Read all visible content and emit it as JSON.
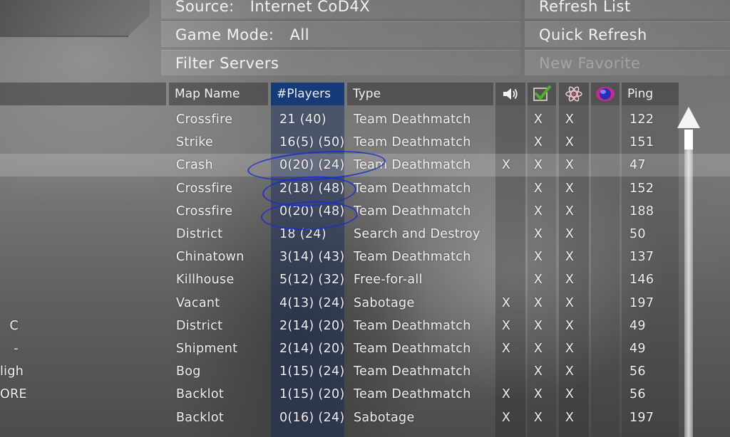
{
  "top": {
    "source_label": "Source:",
    "source_value": "Internet CoD4X",
    "gamemode_label": "Game Mode:",
    "gamemode_value": "All",
    "filter_label": "Filter Servers",
    "refresh_label": "Refresh List",
    "quick_refresh_label": "Quick Refresh",
    "new_favorite_label": "New Favorite"
  },
  "columns": {
    "map_name": "Map Name",
    "players": "#Players",
    "type": "Type",
    "voice_icon": "speaker-icon",
    "pure_icon": "checkmark-icon",
    "mod_icon": "atom-icon",
    "punkbuster_icon": "globe-icon",
    "ping": "Ping"
  },
  "rows": [
    {
      "left": "",
      "map": "Crossfire",
      "players": "21 (40)",
      "type": "Team Deathmatch",
      "voice": "",
      "pure": "X",
      "mod": "X",
      "pb": "",
      "ping": "122"
    },
    {
      "left": "",
      "map": "Strike",
      "players": "16(5) (50)",
      "type": "Team Deathmatch",
      "voice": "",
      "pure": "X",
      "mod": "X",
      "pb": "",
      "ping": "151"
    },
    {
      "left": "",
      "map": "Crash",
      "players": "0(20) (24)",
      "type": "Team Deathmatch",
      "voice": "X",
      "pure": "X",
      "mod": "X",
      "pb": "",
      "ping": "47"
    },
    {
      "left": "",
      "map": "Crossfire",
      "players": "2(18) (48)",
      "type": "Team Deathmatch",
      "voice": "",
      "pure": "X",
      "mod": "X",
      "pb": "",
      "ping": "152"
    },
    {
      "left": "",
      "map": "Crossfire",
      "players": "0(20) (48)",
      "type": "Team Deathmatch",
      "voice": "",
      "pure": "X",
      "mod": "X",
      "pb": "",
      "ping": "188"
    },
    {
      "left": "",
      "map": "District",
      "players": "18 (24)",
      "type": "Search and Destroy",
      "voice": "",
      "pure": "X",
      "mod": "X",
      "pb": "",
      "ping": "50"
    },
    {
      "left": "",
      "map": "Chinatown",
      "players": "3(14) (43)",
      "type": "Team Deathmatch",
      "voice": "",
      "pure": "X",
      "mod": "X",
      "pb": "",
      "ping": "137"
    },
    {
      "left": "",
      "map": "Killhouse",
      "players": "5(12) (32)",
      "type": "Free-for-all",
      "voice": "",
      "pure": "X",
      "mod": "X",
      "pb": "",
      "ping": "146"
    },
    {
      "left": "",
      "map": "Vacant",
      "players": "4(13) (24)",
      "type": "Sabotage",
      "voice": "X",
      "pure": "X",
      "mod": "X",
      "pb": "",
      "ping": "197"
    },
    {
      "left": "C",
      "map": "District",
      "players": "2(14) (20)",
      "type": "Team Deathmatch",
      "voice": "X",
      "pure": "X",
      "mod": "X",
      "pb": "",
      "ping": "49"
    },
    {
      "left": "-",
      "map": "Shipment",
      "players": "2(14) (20)",
      "type": "Team Deathmatch",
      "voice": "X",
      "pure": "X",
      "mod": "X",
      "pb": "",
      "ping": "49"
    },
    {
      "left": "ligh",
      "map": "Bog",
      "players": "1(15) (24)",
      "type": "Team Deathmatch",
      "voice": "",
      "pure": "X",
      "mod": "X",
      "pb": "",
      "ping": "56"
    },
    {
      "left": "ORE",
      "map": "Backlot",
      "players": "1(15) (20)",
      "type": "Team Deathmatch",
      "voice": "X",
      "pure": "X",
      "mod": "X",
      "pb": "",
      "ping": "56"
    },
    {
      "left": "",
      "map": "Backlot",
      "players": "0(16) (24)",
      "type": "Sabotage",
      "voice": "X",
      "pure": "X",
      "mod": "X",
      "pb": "",
      "ping": "197"
    }
  ],
  "selected_row": 2
}
